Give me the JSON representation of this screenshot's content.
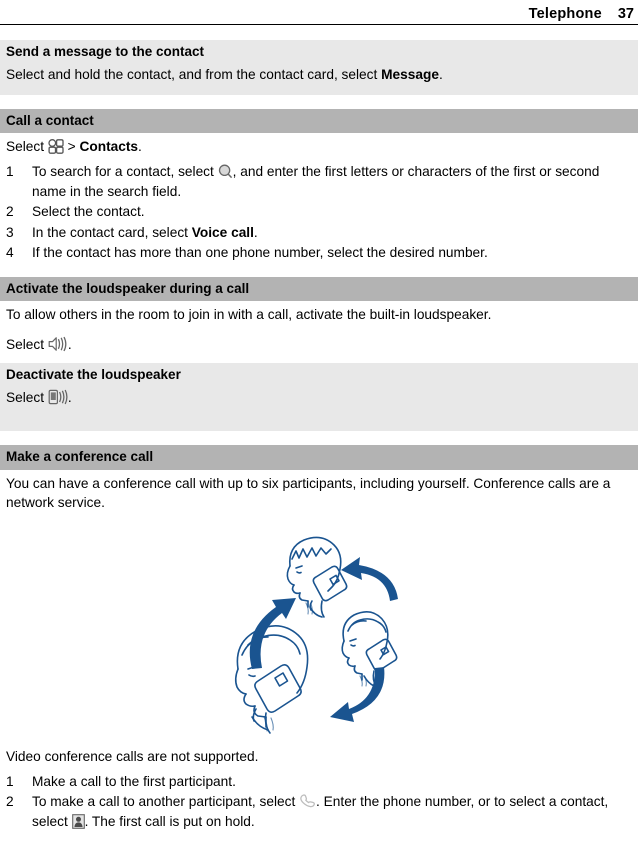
{
  "header": {
    "title": "Telephone",
    "page_number": "37"
  },
  "sections": [
    {
      "id": "send-message",
      "heading": "Send a message to the contact",
      "body_prefix": "Select and hold the contact, and from the contact card, select ",
      "body_bold": "Message",
      "body_suffix": "."
    },
    {
      "id": "call-contact",
      "heading": "Call a contact",
      "select_label": "Select",
      "menu_icon": "menu-grid-icon",
      "select_sep": ">",
      "select_target": "Contacts",
      "select_period": ".",
      "steps": [
        {
          "num": "1",
          "prefix": "To search for a contact, select ",
          "icon": "search-icon",
          "suffix": ", and enter the first letters or characters of the first or second name in the search field."
        },
        {
          "num": "2",
          "prefix": "Select the contact.",
          "icon": "",
          "suffix": ""
        },
        {
          "num": "3",
          "prefix": "In the contact card, select ",
          "bold": "Voice call",
          "icon": "",
          "suffix": "."
        },
        {
          "num": "4",
          "prefix": "If the contact has more than one phone number, select the desired number.",
          "icon": "",
          "suffix": ""
        }
      ]
    },
    {
      "id": "activate-loudspeaker",
      "heading": "Activate the loudspeaker during a call",
      "body": "To allow others in the room to join in with a call, activate the built-in loudspeaker.",
      "select_label": "Select ",
      "icon": "loudspeaker-icon",
      "select_period": "."
    },
    {
      "id": "deactivate-loudspeaker",
      "heading": "Deactivate the loudspeaker",
      "select_label": "Select ",
      "icon": "handset-speaker-icon",
      "select_period": "."
    },
    {
      "id": "conference-call",
      "heading": "Make a conference call",
      "body": "You can have a conference call with up to six participants, including yourself. Conference calls are a network service.",
      "illustration_alt": "conference-call-illustration",
      "note": "Video conference calls are not supported.",
      "steps": [
        {
          "num": "1",
          "prefix": "Make a call to the first participant.",
          "icon": "",
          "suffix": ""
        },
        {
          "num": "2",
          "prefix": "To make a call to another participant, select ",
          "icon": "call-handset-icon",
          "mid": ". Enter the phone number, or to select a contact, select ",
          "icon2": "contact-card-icon",
          "suffix": ". The first call is put on hold."
        }
      ]
    }
  ],
  "colors": {
    "band_light": "#e8e8e8",
    "band_dark": "#b3b3b3",
    "illustration_blue": "#1a5490",
    "text": "#000000",
    "page_background": "#ffffff"
  }
}
